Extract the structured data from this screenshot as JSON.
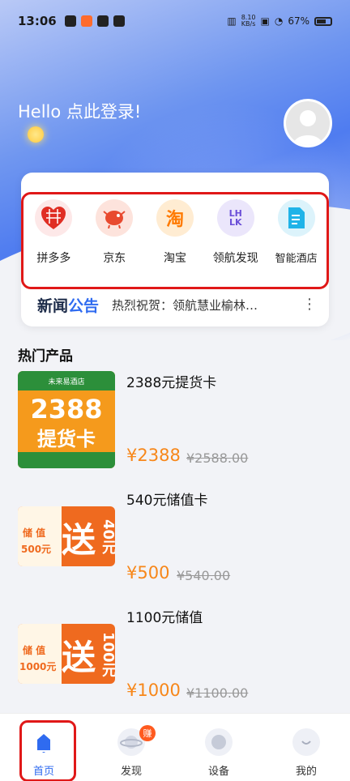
{
  "status_bar": {
    "time": "13:06",
    "network_speed_value": "8.10",
    "network_speed_unit": "KB/s",
    "battery": "67%"
  },
  "header": {
    "greeting": "Hello 点此登录!"
  },
  "shortcuts": [
    {
      "label": "拼多多",
      "icon": "pinduoduo-icon",
      "color": "#e02e24"
    },
    {
      "label": "京东",
      "icon": "jd-icon",
      "color": "#e84a2f"
    },
    {
      "label": "淘宝",
      "icon": "taobao-icon",
      "icon_text": "淘",
      "color": "#ff7a00"
    },
    {
      "label": "领航发现",
      "icon": "linghang-icon",
      "icon_text": "LHLK",
      "color": "#6b4fd8"
    },
    {
      "label": "智能酒店",
      "icon": "hotel-icon",
      "color": "#1fb3e8"
    }
  ],
  "news": {
    "title_part1": "新闻",
    "title_part2": "公告",
    "text": "热烈祝贺：领航慧业榆林…"
  },
  "products_section": {
    "title": "热门产品"
  },
  "products": [
    {
      "name": "2388元提货卡",
      "price": "¥2388",
      "old_price": "¥2588.00",
      "img_brand": "未来易酒店",
      "img_big": "2388",
      "img_sub": "提货卡"
    },
    {
      "name": "540元储值卡",
      "price": "¥500",
      "old_price": "¥540.00",
      "img_left1": "储 值",
      "img_left2": "500元",
      "img_big": "送",
      "img_amount": "40元"
    },
    {
      "name": "1100元储值",
      "price": "¥1000",
      "old_price": "¥1100.00",
      "img_left1": "储 值",
      "img_left2": "1000元",
      "img_big": "送",
      "img_amount": "100元"
    }
  ],
  "tabbar": {
    "tabs": [
      {
        "label": "首页",
        "active": true
      },
      {
        "label": "发现",
        "badge": "赚"
      },
      {
        "label": "设备"
      },
      {
        "label": "我的"
      }
    ]
  },
  "colors": {
    "accent": "#2f6bf0",
    "price": "#f7871a",
    "highlight_box": "#e01818"
  }
}
